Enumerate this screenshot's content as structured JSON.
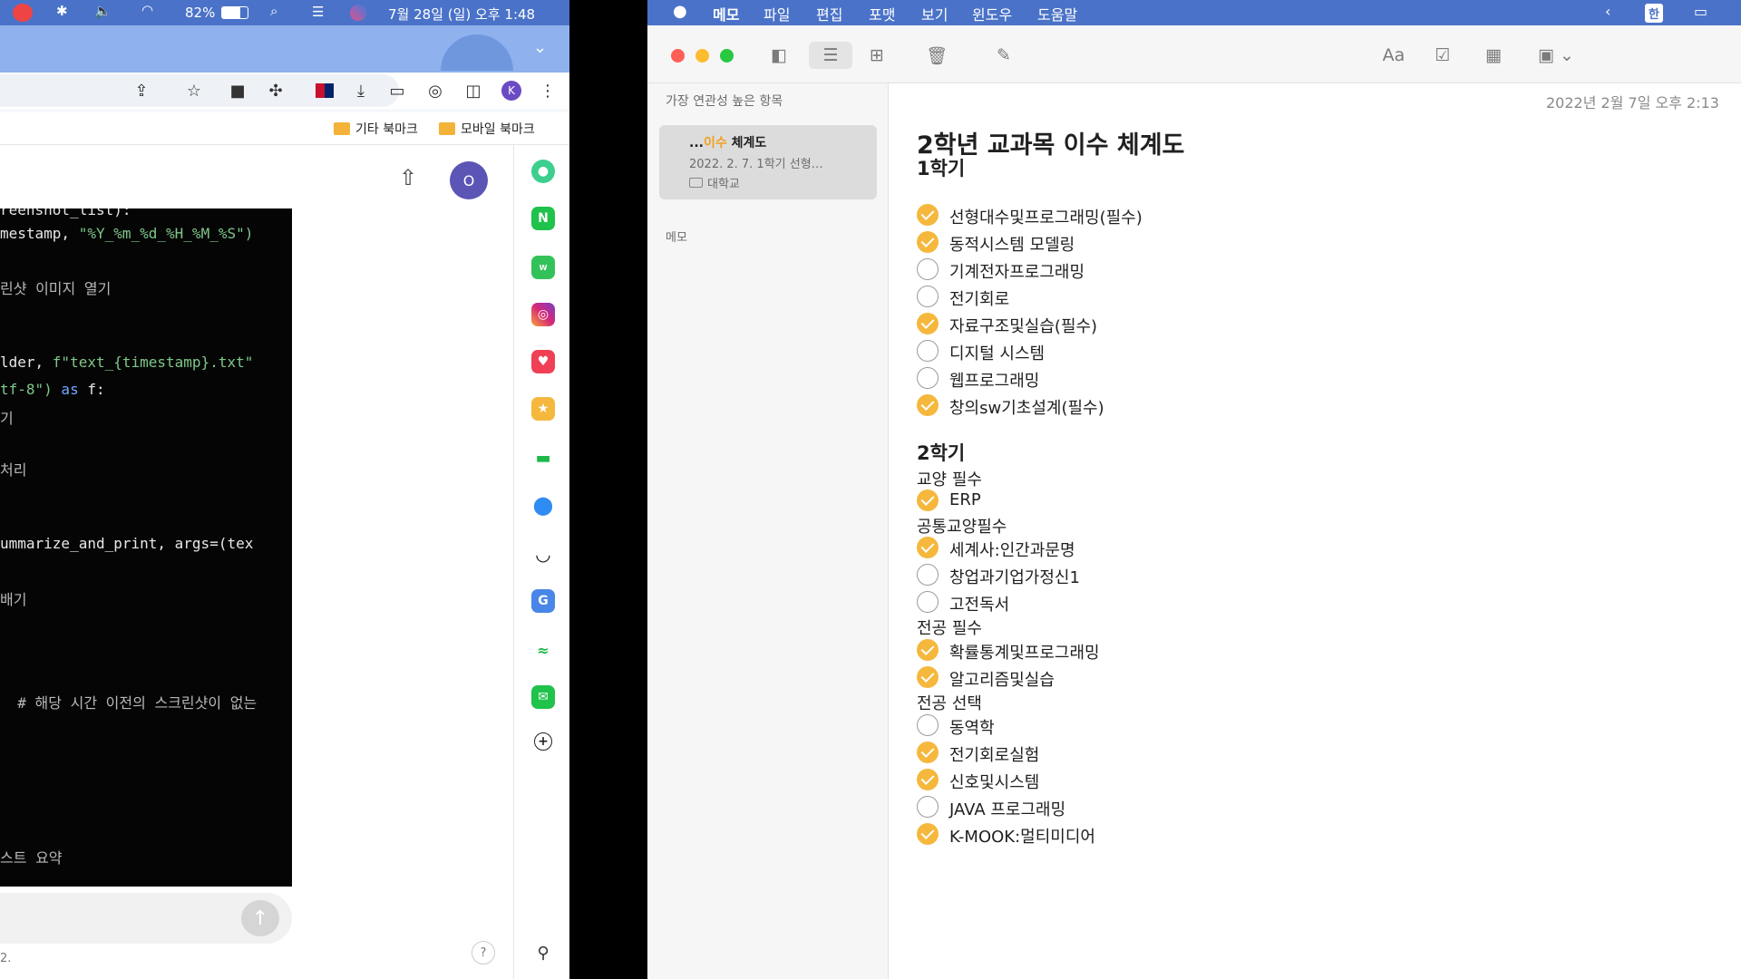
{
  "system_bar": {
    "battery": "82%",
    "datetime": "7월 28일 (일) 오후 1:48"
  },
  "browser": {
    "avatar_initial": "K",
    "bookmarks": [
      "기타 북마크",
      "모바일 북마크"
    ],
    "page_avatar": "O",
    "code_lines": [
      {
        "text": "reenshot_list):",
        "cls": ""
      },
      {
        "text": "mestamp, ",
        "cls": "",
        "str": "\"%Y_%m_%d_%H_%M_%S\")"
      },
      {
        "text": "린샷 이미지 열기",
        "cls": "cm"
      },
      {
        "text": "lder, ",
        "cls": "",
        "str": "f\"text_{timestamp}.txt\""
      },
      {
        "text": "tf-8\")",
        "cls": "str",
        "kw": " as ",
        "rest": "f:"
      },
      {
        "text": "기",
        "cls": "cm"
      },
      {
        "text": "처리",
        "cls": "cm"
      },
      {
        "text": "ummarize_and_print, args=(tex",
        "cls": ""
      },
      {
        "text": "배기",
        "cls": "cm"
      },
      {
        "text": "  # 해당 시간 이전의 스크린샷이 없는",
        "cls": "cm"
      },
      {
        "text": "스트 요약",
        "cls": "cm"
      }
    ],
    "footer_text": "2."
  },
  "notes_app": {
    "menu": [
      "메모",
      "파일",
      "편집",
      "포맷",
      "보기",
      "윈도우",
      "도움말"
    ],
    "input_source": "한",
    "list_header": "가장 연관성 높은 항목",
    "note_card": {
      "title_prefix": "...",
      "title_highlight": "이수",
      "title_rest": " 체계도",
      "preview": "2022. 2. 7.  1학기 선형…",
      "folder": "대학교"
    },
    "memo_section": "메모",
    "note_date": "2022년 2월 7일 오후 2:13",
    "note": {
      "title": "2학년 교과목 이수 체계도",
      "semester1": "1학기",
      "sem1_items": [
        {
          "label": "선형대수및프로그래밍(필수)",
          "checked": true
        },
        {
          "label": "동적시스템 모델링",
          "checked": true
        },
        {
          "label": "기계전자프로그래밍",
          "checked": false
        },
        {
          "label": "전기회로",
          "checked": false
        },
        {
          "label": "자료구조및실습(필수)",
          "checked": true
        },
        {
          "label": "디지털 시스템",
          "checked": false
        },
        {
          "label": "웹프로그래밍",
          "checked": false
        },
        {
          "label": "창의sw기초설계(필수)",
          "checked": true
        }
      ],
      "semester2": "2학기",
      "group_gyoyang": "교양 필수",
      "gyoyang_items": [
        {
          "label": "ERP",
          "checked": true
        }
      ],
      "group_common": "공통교양필수",
      "common_items": [
        {
          "label": "세계사:인간과문명",
          "checked": true
        },
        {
          "label": "창업과기업가정신1",
          "checked": false
        },
        {
          "label": "고전독서",
          "checked": false
        }
      ],
      "group_major_req": "전공 필수",
      "major_req_items": [
        {
          "label": "확률통계및프로그래밍",
          "checked": true
        },
        {
          "label": "알고리즘및실습",
          "checked": true
        }
      ],
      "group_major_elec": "전공 선택",
      "major_elec_items": [
        {
          "label": "동역학",
          "checked": false
        },
        {
          "label": "전기회로실험",
          "checked": true
        },
        {
          "label": "신호및시스템",
          "checked": true
        },
        {
          "label": "JAVA 프로그래밍",
          "checked": false
        },
        {
          "label": "K-MOOK:멀티미디어",
          "checked": true
        }
      ]
    }
  },
  "colors": {
    "menubar": "#4a72c8",
    "check_accent": "#f5b83d",
    "note_highlight": "#f0a020"
  }
}
